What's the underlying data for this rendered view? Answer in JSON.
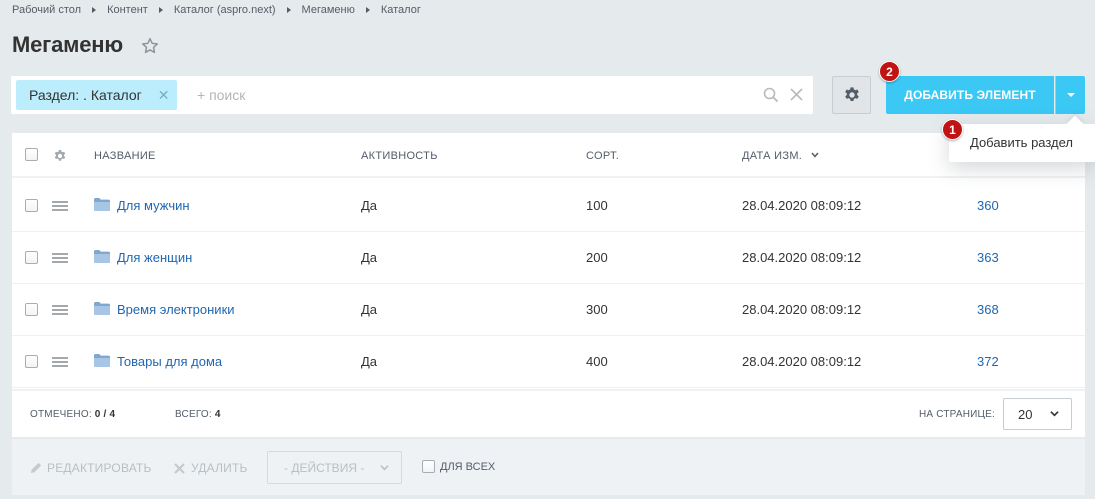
{
  "breadcrumb": [
    "Рабочий стол",
    "Контент",
    "Каталог (aspro.next)",
    "Мегаменю",
    "Каталог"
  ],
  "page_title": "Мегаменю",
  "filter": {
    "tag_label": "Раздел:  . Каталог",
    "search_placeholder": "+ поиск"
  },
  "toolbar": {
    "add_label": "ДОБАВИТЬ ЭЛЕМЕНТ",
    "badge_add": "2",
    "badge_menu": "1",
    "menu_items": [
      "Добавить раздел"
    ]
  },
  "grid": {
    "columns": [
      "НАЗВАНИЕ",
      "АКТИВНОСТЬ",
      "СОРТ.",
      "ДАТА ИЗМ."
    ],
    "rows": [
      {
        "name": "Для мужчин",
        "active": "Да",
        "sort": "100",
        "date": "28.04.2020 08:09:12",
        "id": "360"
      },
      {
        "name": "Для женщин",
        "active": "Да",
        "sort": "200",
        "date": "28.04.2020 08:09:12",
        "id": "363"
      },
      {
        "name": "Время электроники",
        "active": "Да",
        "sort": "300",
        "date": "28.04.2020 08:09:12",
        "id": "368"
      },
      {
        "name": "Товары для дома",
        "active": "Да",
        "sort": "400",
        "date": "28.04.2020 08:09:12",
        "id": "372"
      }
    ]
  },
  "footer": {
    "selected_label": "ОТМЕЧЕНО:",
    "selected_value": "0 / 4",
    "total_label": "ВСЕГО:",
    "total_value": "4",
    "per_page_label": "НА СТРАНИЦЕ:",
    "per_page_value": "20"
  },
  "actions": {
    "edit_label": "РЕДАКТИРОВАТЬ",
    "delete_label": "УДАЛИТЬ",
    "actions_select": "- ДЕЙСТВИЯ -",
    "for_all_label": "ДЛЯ ВСЕХ"
  },
  "colors": {
    "accent": "#3bc8f5",
    "badge": "#c01414",
    "link": "#2067b0",
    "filter_tag": "#bcedfc"
  }
}
